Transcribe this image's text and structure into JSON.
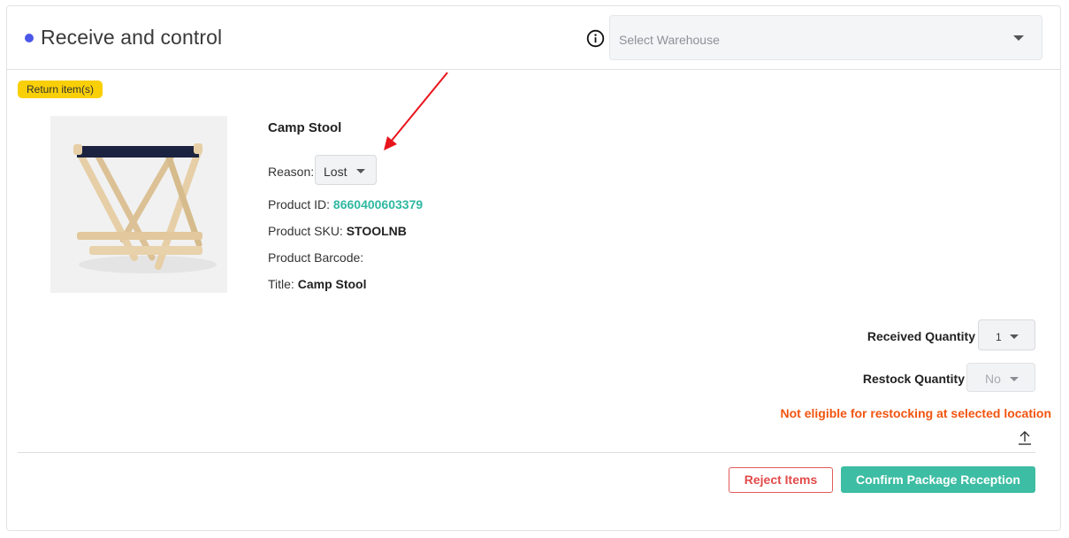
{
  "header": {
    "title": "Receive and control",
    "status_dot_color": "#4a57e8",
    "info_icon": "info-circle-icon",
    "warehouse_select": {
      "placeholder": "Select Warehouse"
    }
  },
  "badge": {
    "label": "Return item(s)",
    "color": "#f9cf08"
  },
  "product": {
    "name": "Camp Stool",
    "image_icon": "camp-stool-product-image",
    "reason_label": "Reason:",
    "reason_value": "Lost",
    "id_label": "Product ID:",
    "id_value": "8660400603379",
    "sku_label": "Product SKU:",
    "sku_value": "STOOLNB",
    "barcode_label": "Product Barcode:",
    "barcode_value": "",
    "title_label": "Title:",
    "title_value": "Camp Stool"
  },
  "quantities": {
    "received_label": "Received Quantity",
    "received_value": "1",
    "restock_label": "Restock Quantity",
    "restock_value": "No"
  },
  "warning": {
    "text": "Not eligible for restocking at selected location",
    "color": "#f2540f"
  },
  "actions": {
    "reject_label": "Reject Items",
    "confirm_label": "Confirm Package Reception",
    "upload_icon": "upload-icon"
  },
  "colors": {
    "accent": "#3dbda3",
    "danger": "#e24a4a",
    "link": "#2fb8a0",
    "annotation_arrow": "#e8141c"
  }
}
